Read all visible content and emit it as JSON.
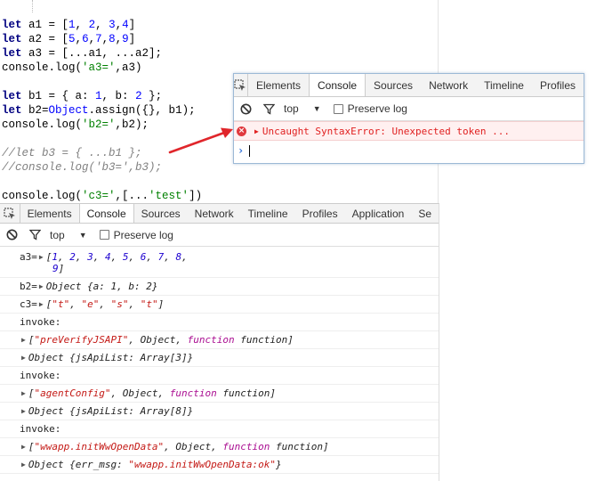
{
  "code": {
    "lines": [
      [
        [
          "k",
          "let"
        ],
        [
          "v",
          " a1 = ["
        ],
        [
          "n",
          "1"
        ],
        [
          "v",
          ", "
        ],
        [
          "n",
          "2"
        ],
        [
          "v",
          ", "
        ],
        [
          "n",
          "3"
        ],
        [
          "v",
          ","
        ],
        [
          "n",
          "4"
        ],
        [
          "v",
          "]"
        ]
      ],
      [
        [
          "k",
          "let"
        ],
        [
          "v",
          " a2 = ["
        ],
        [
          "n",
          "5"
        ],
        [
          "v",
          ","
        ],
        [
          "n",
          "6"
        ],
        [
          "v",
          ","
        ],
        [
          "n",
          "7"
        ],
        [
          "v",
          ","
        ],
        [
          "n",
          "8"
        ],
        [
          "v",
          ","
        ],
        [
          "n",
          "9"
        ],
        [
          "v",
          "]"
        ]
      ],
      [
        [
          "k",
          "let"
        ],
        [
          "v",
          " a3 = [...a1, ...a2];"
        ]
      ],
      [
        [
          "v",
          "console.log("
        ],
        [
          "s",
          "'a3='"
        ],
        [
          "v",
          ",a3)"
        ]
      ],
      [
        [
          "v",
          ""
        ]
      ],
      [
        [
          "k",
          "let"
        ],
        [
          "v",
          " b1 = { a: "
        ],
        [
          "n",
          "1"
        ],
        [
          "v",
          ", b: "
        ],
        [
          "n",
          "2"
        ],
        [
          "v",
          " };"
        ]
      ],
      [
        [
          "k",
          "let"
        ],
        [
          "v",
          " b2="
        ],
        [
          "n",
          "Object"
        ],
        [
          "v",
          ".assign({}, b1);"
        ]
      ],
      [
        [
          "v",
          "console.log("
        ],
        [
          "s",
          "'b2='"
        ],
        [
          "v",
          ",b2);"
        ]
      ],
      [
        [
          "v",
          ""
        ]
      ],
      [
        [
          "c",
          "//let b3 = { ...b1 };"
        ]
      ],
      [
        [
          "c",
          "//console.log('b3=',b3);"
        ]
      ],
      [
        [
          "v",
          ""
        ]
      ],
      [
        [
          "v",
          "console.log("
        ],
        [
          "s",
          "'c3='"
        ],
        [
          "v",
          ",[..."
        ],
        [
          "s",
          "'test'"
        ],
        [
          "v",
          "])"
        ]
      ]
    ]
  },
  "devtools": {
    "tabs": [
      "Elements",
      "Console",
      "Sources",
      "Network",
      "Timeline",
      "Profiles",
      "Application",
      "Se"
    ],
    "active_tab": "Console",
    "context": "top",
    "preserve_log_label": "Preserve log",
    "console": [
      {
        "type": "arr_wrap",
        "prefix": "a3=",
        "items": [
          "1",
          "2",
          "3",
          "4",
          "5",
          "6",
          "7",
          "8",
          "9"
        ]
      },
      {
        "type": "obj",
        "prefix": "b2=",
        "text": "Object {a: 1, b: 2}"
      },
      {
        "type": "chars",
        "prefix": "c3=",
        "items": [
          "\"t\"",
          "\"e\"",
          "\"s\"",
          "\"t\""
        ]
      },
      {
        "type": "plain",
        "text": "invoke:"
      },
      {
        "type": "call",
        "name": "\"preVerifyJSAPI\"",
        "mid": ", Object, ",
        "fn": "function function"
      },
      {
        "type": "obj",
        "prefix": "",
        "text": "Object {jsApiList: Array[3]}"
      },
      {
        "type": "plain",
        "text": "invoke:"
      },
      {
        "type": "call",
        "name": "\"agentConfig\"",
        "mid": ", Object, ",
        "fn": "function function"
      },
      {
        "type": "obj",
        "prefix": "",
        "text": "Object {jsApiList: Array[8]}"
      },
      {
        "type": "plain",
        "text": "invoke:"
      },
      {
        "type": "call",
        "name": "\"wwapp.initWwOpenData\"",
        "mid": ", Object, ",
        "fn": "function function"
      },
      {
        "type": "errobj",
        "key": "Object {err_msg: ",
        "val": "\"wwapp.initWwOpenData:ok\"",
        "tail": "}"
      }
    ]
  },
  "popup": {
    "tabs": [
      "Elements",
      "Console",
      "Sources",
      "Network",
      "Timeline",
      "Profiles"
    ],
    "active_tab": "Console",
    "context": "top",
    "preserve_log_label": "Preserve log",
    "error_text": "Uncaught SyntaxError: Unexpected token ..."
  },
  "colors": {
    "arrow": "#e0262b",
    "error": "#e02020",
    "keyword": "#000080",
    "number": "#0000ff",
    "string": "#008000",
    "comment": "#808080"
  },
  "icons": [
    "inspect-icon",
    "clear-console-icon",
    "filter-icon",
    "caret-down-icon",
    "error-icon",
    "expand-triangle-icon",
    "prompt-chevron-icon"
  ]
}
